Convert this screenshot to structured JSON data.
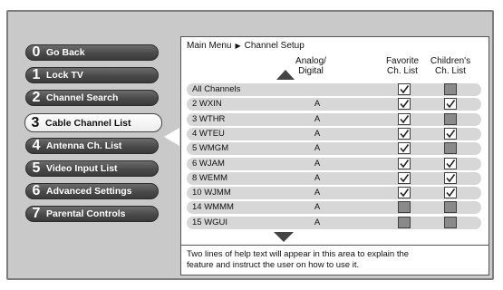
{
  "menu": {
    "items": [
      {
        "number": "0",
        "label": "Go Back"
      },
      {
        "number": "1",
        "label": "Lock TV"
      },
      {
        "number": "2",
        "label": "Channel Search"
      },
      {
        "number": "3",
        "label": "Cable Channel List",
        "selected": true
      },
      {
        "number": "4",
        "label": "Antenna Ch. List"
      },
      {
        "number": "5",
        "label": "Video Input List"
      },
      {
        "number": "6",
        "label": "Advanced Settings"
      },
      {
        "number": "7",
        "label": "Parental Controls"
      }
    ]
  },
  "breadcrumb": {
    "parent": "Main Menu",
    "current": "Channel Setup"
  },
  "columns": {
    "type_line1": "Analog/",
    "type_line2": "Digital",
    "favorite_line1": "Favorite",
    "favorite_line2": "Ch. List",
    "children_line1": "Children's",
    "children_line2": "Ch. List"
  },
  "channels": [
    {
      "name": "All Channels",
      "type": "",
      "favorite": true,
      "children": false
    },
    {
      "name": "2 WXIN",
      "type": "A",
      "favorite": true,
      "children": true
    },
    {
      "name": "3 WTHR",
      "type": "A",
      "favorite": true,
      "children": false
    },
    {
      "name": "4 WTEU",
      "type": "A",
      "favorite": true,
      "children": true
    },
    {
      "name": "5 WMGM",
      "type": "A",
      "favorite": true,
      "children": false
    },
    {
      "name": "6 WJAM",
      "type": "A",
      "favorite": true,
      "children": true
    },
    {
      "name": "8 WEMM",
      "type": "A",
      "favorite": true,
      "children": true
    },
    {
      "name": "10 WJMM",
      "type": "A",
      "favorite": true,
      "children": true
    },
    {
      "name": "14 WMMM",
      "type": "A",
      "favorite": false,
      "children": false
    },
    {
      "name": "15 WGUI",
      "type": "A",
      "favorite": false,
      "children": false
    }
  ],
  "help": {
    "line1": "Two lines of help text will appear in this area to explain the",
    "line2": "feature and instruct the user on how to use it."
  }
}
